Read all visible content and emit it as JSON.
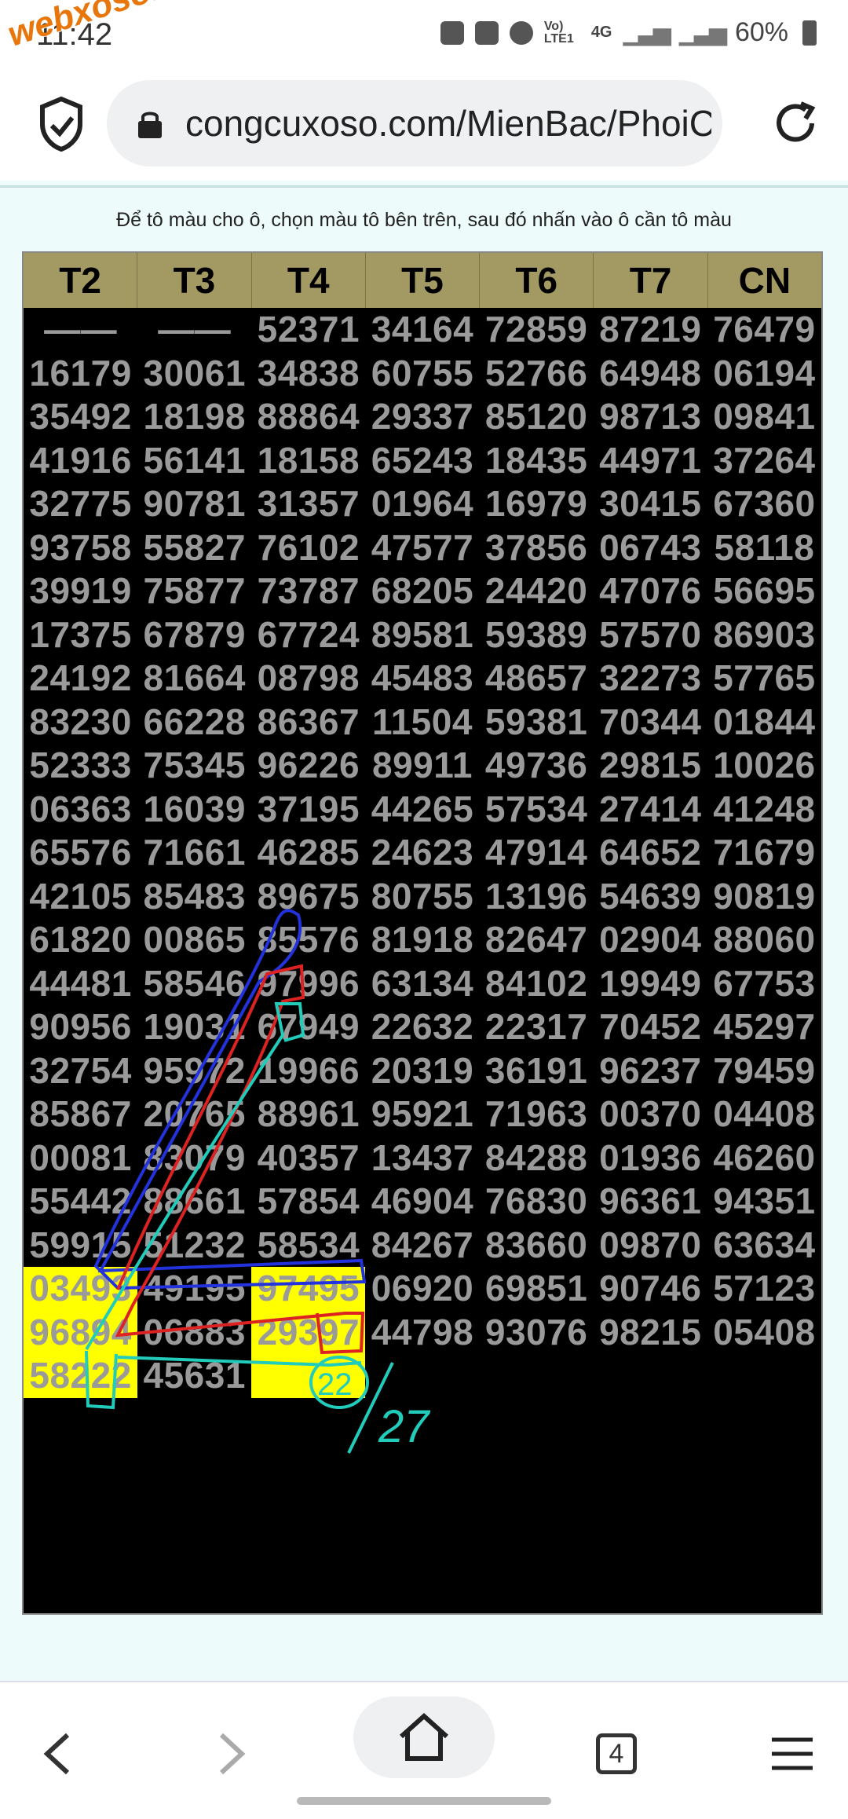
{
  "status": {
    "time": "11:42",
    "battery": "60%",
    "network": "4G",
    "volte": "Vo) LTE1"
  },
  "watermark": "webxoso.net",
  "browser": {
    "url": "congcuxoso.com/MienBac/PhoiCa",
    "tab_count": "4"
  },
  "instruction": "Để tô màu cho ô, chọn màu tô bên trên, sau đó nhấn vào ô cần tô màu",
  "table": {
    "headers": [
      "T2",
      "T3",
      "T4",
      "T5",
      "T6",
      "T7",
      "CN"
    ],
    "rows": [
      [
        "——",
        "——",
        "52371",
        "34164",
        "72859",
        "87219",
        "76479"
      ],
      [
        "16179",
        "30061",
        "34838",
        "60755",
        "52766",
        "64948",
        "06194"
      ],
      [
        "35492",
        "18198",
        "88864",
        "29337",
        "85120",
        "98713",
        "09841"
      ],
      [
        "41916",
        "56141",
        "18158",
        "65243",
        "18435",
        "44971",
        "37264"
      ],
      [
        "32775",
        "90781",
        "31357",
        "01964",
        "16979",
        "30415",
        "67360"
      ],
      [
        "93758",
        "55827",
        "76102",
        "47577",
        "37856",
        "06743",
        "58118"
      ],
      [
        "39919",
        "75877",
        "73787",
        "68205",
        "24420",
        "47076",
        "56695"
      ],
      [
        "17375",
        "67879",
        "67724",
        "89581",
        "59389",
        "57570",
        "86903"
      ],
      [
        "24192",
        "81664",
        "08798",
        "45483",
        "48657",
        "32273",
        "57765"
      ],
      [
        "83230",
        "66228",
        "86367",
        "11504",
        "59381",
        "70344",
        "01844"
      ],
      [
        "52333",
        "75345",
        "96226",
        "89911",
        "49736",
        "29815",
        "10026"
      ],
      [
        "06363",
        "16039",
        "37195",
        "44265",
        "57534",
        "27414",
        "41248"
      ],
      [
        "65576",
        "71661",
        "46285",
        "24623",
        "47914",
        "64652",
        "71679"
      ],
      [
        "42105",
        "85483",
        "89675",
        "80755",
        "13196",
        "54639",
        "90819"
      ],
      [
        "61820",
        "00865",
        "85576",
        "81918",
        "82647",
        "02904",
        "88060"
      ],
      [
        "44481",
        "58546",
        "97996",
        "63134",
        "84102",
        "19949",
        "67753"
      ],
      [
        "90956",
        "19031",
        "67949",
        "22632",
        "22317",
        "70452",
        "45297"
      ],
      [
        "32754",
        "95972",
        "19966",
        "20319",
        "36191",
        "96237",
        "79459"
      ],
      [
        "85867",
        "20765",
        "88961",
        "95921",
        "71963",
        "00370",
        "04408"
      ],
      [
        "00081",
        "83079",
        "40357",
        "13437",
        "84288",
        "01936",
        "46260"
      ],
      [
        "55442",
        "88661",
        "57854",
        "46904",
        "76830",
        "96361",
        "94351"
      ],
      [
        "59915",
        "51232",
        "58534",
        "84267",
        "83660",
        "09870",
        "63634"
      ],
      [
        "03493",
        "49195",
        "97495",
        "06920",
        "69851",
        "90746",
        "57123"
      ],
      [
        "96894",
        "06883",
        "29397",
        "44798",
        "93076",
        "98215",
        "05408"
      ],
      [
        "58222",
        "45631",
        "",
        "",
        "",
        "",
        ""
      ]
    ],
    "highlighted": [
      [
        22,
        0
      ],
      [
        22,
        2
      ],
      [
        23,
        0
      ],
      [
        23,
        2
      ],
      [
        24,
        0
      ],
      [
        24,
        2
      ]
    ]
  },
  "annotation": {
    "circled": "22",
    "note": "27"
  },
  "colors": {
    "header_bg": "#a29a62",
    "highlight": "#ffff00",
    "board_bg": "#000000",
    "digits": "#9a9a9a"
  }
}
